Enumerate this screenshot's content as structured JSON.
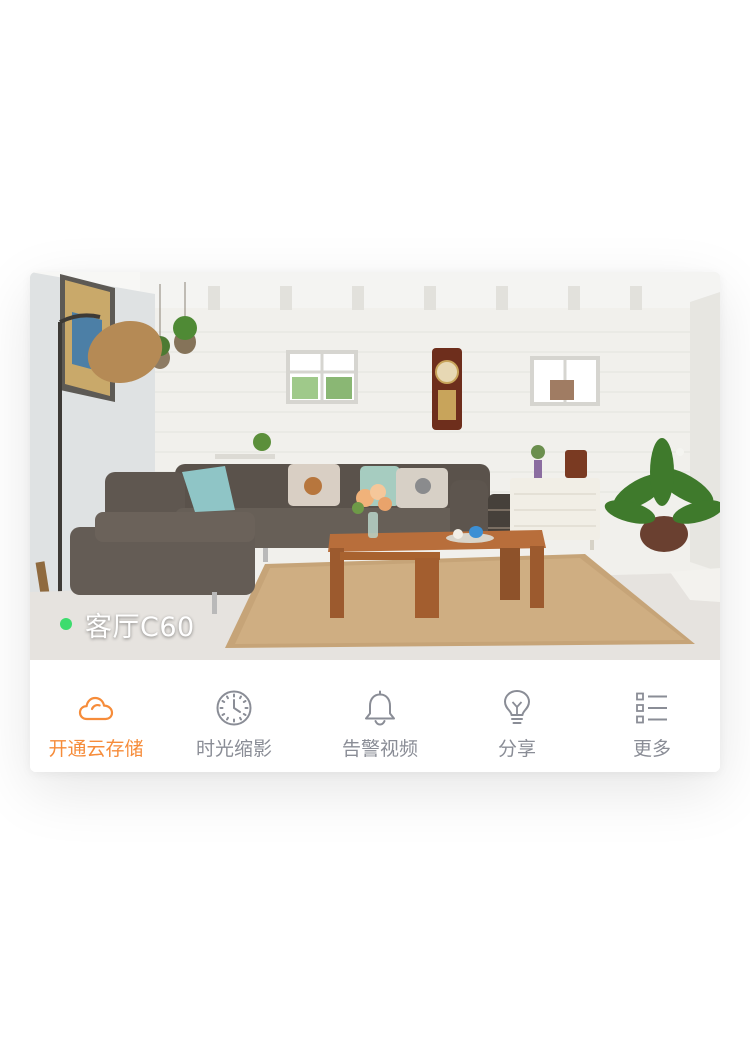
{
  "camera": {
    "name": "客厅C60",
    "status": "online",
    "status_color": "#3ddc6e",
    "preview_scene": "living-room"
  },
  "toolbar": {
    "accent_color": "#f68c3a",
    "inactive_color": "#8a8d96",
    "items": [
      {
        "label": "开通云存储",
        "icon": "cloud-icon",
        "active": true
      },
      {
        "label": "时光缩影",
        "icon": "clock-icon",
        "active": false
      },
      {
        "label": "告警视频",
        "icon": "bell-icon",
        "active": false
      },
      {
        "label": "分享",
        "icon": "lightbulb-icon",
        "active": false
      },
      {
        "label": "更多",
        "icon": "list-icon",
        "active": false
      }
    ]
  }
}
